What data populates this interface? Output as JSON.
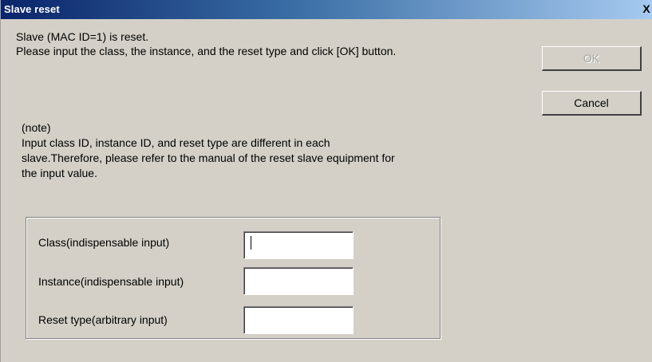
{
  "window": {
    "title": "Slave reset",
    "close_glyph": "X"
  },
  "message": {
    "line1": "Slave (MAC ID=1) is reset.",
    "line2": "Please input the class, the instance, and the reset type and click [OK] button."
  },
  "note": {
    "heading": "(note)",
    "line1": "Input class ID, instance ID, and reset type are different in each",
    "line2": "slave.Therefore, please refer to the manual of the reset slave equipment for",
    "line3": "the input value."
  },
  "buttons": {
    "ok_label": "OK",
    "ok_enabled": false,
    "cancel_label": "Cancel"
  },
  "fields": [
    {
      "label": "Class(indispensable input)",
      "value": "",
      "focused": true
    },
    {
      "label": "Instance(indispensable input)",
      "value": "",
      "focused": false
    },
    {
      "label": "Reset type(arbitrary input)",
      "value": "",
      "focused": false
    }
  ],
  "colors": {
    "dialog_bg": "#d4d0c8",
    "titlebar_start": "#0a246a",
    "titlebar_end": "#a6caf0",
    "title_text": "#ffffff",
    "disabled_text": "#a6a6a6"
  }
}
